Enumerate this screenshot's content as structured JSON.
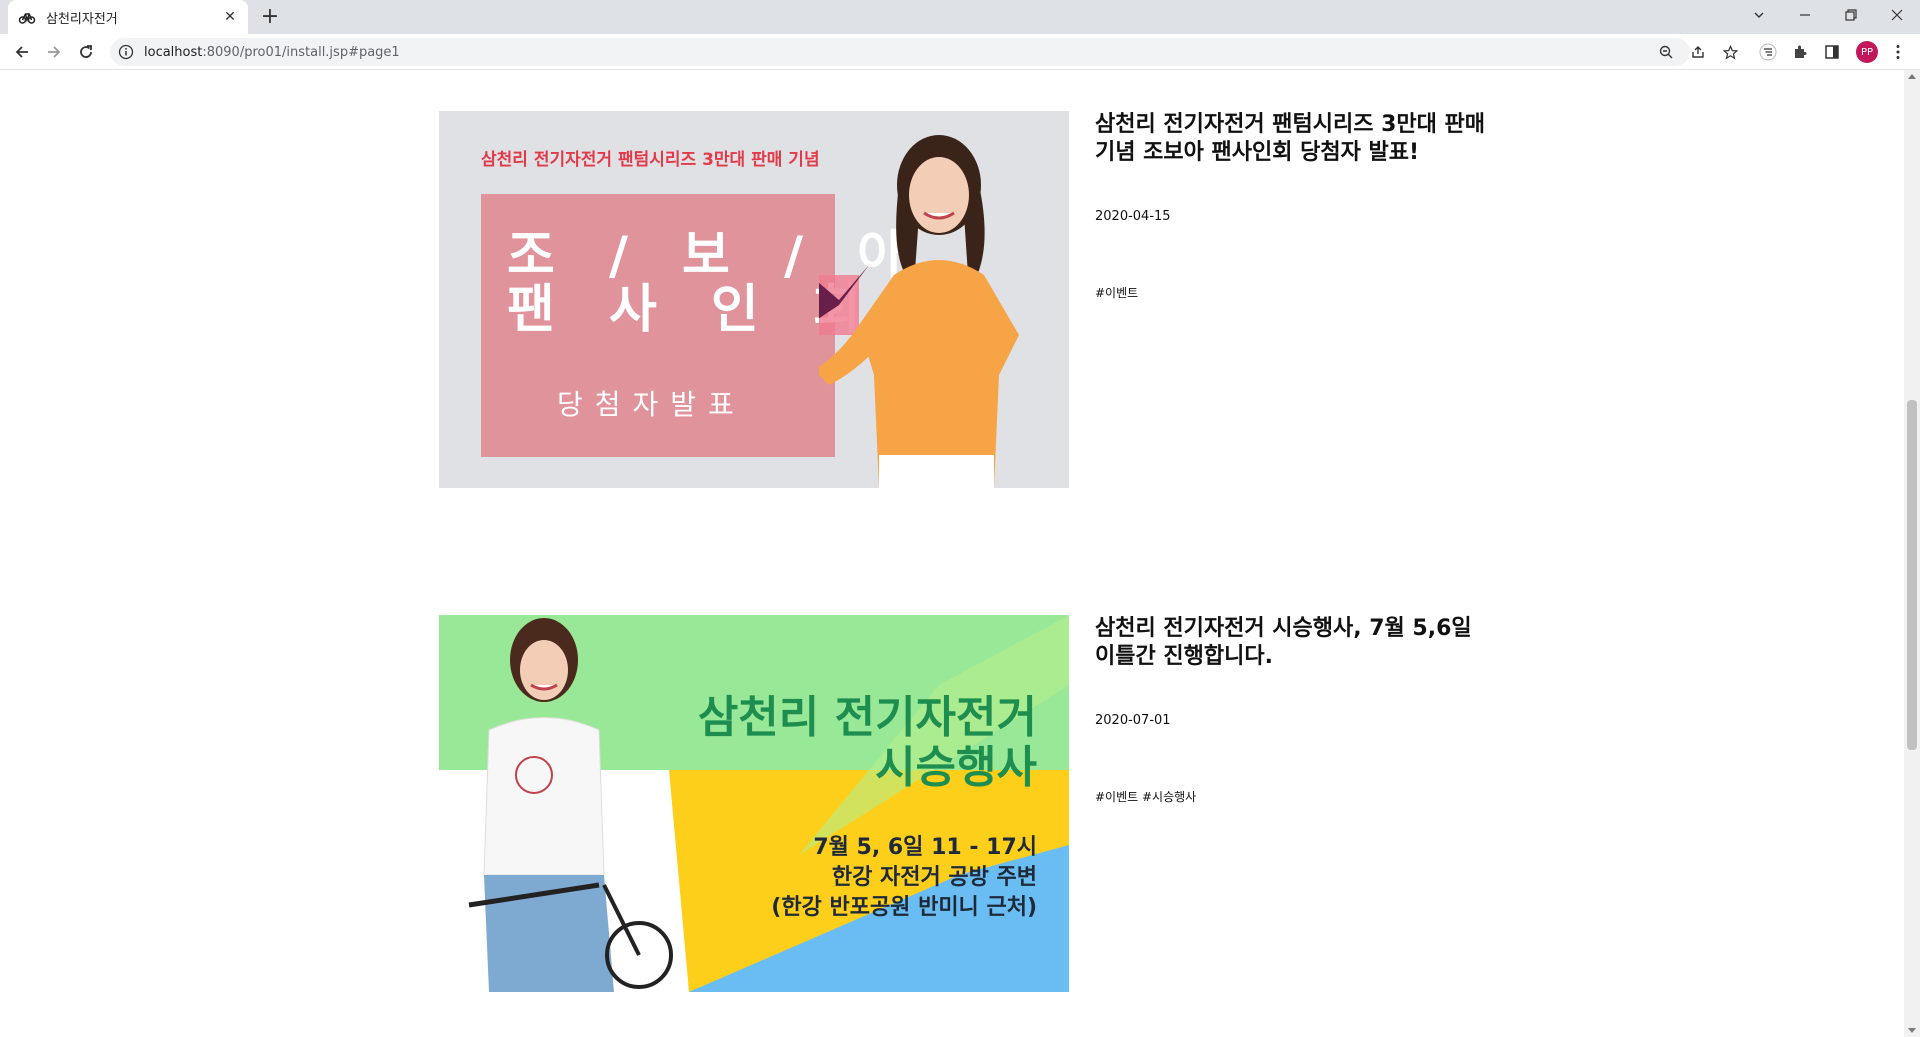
{
  "browser": {
    "tab_title": "삼천리자전거",
    "url_host": "localhost",
    "url_path": ":8090/pro01/install.jsp#page1",
    "profile_initials": "PP"
  },
  "posts": [
    {
      "title": "삼천리 전기자전거 팬텀시리즈 3만대 판매 기념 조보아 팬사인회 당첨자 발표!",
      "date": "2020-04-15",
      "tags": "#이벤트",
      "banner": {
        "top_text": "삼천리 전기자전거 팬텀시리즈 3만대 판매 기념",
        "big_line1": "조 / 보 / 아",
        "big_line2": "팬 사 인 회",
        "sub_text": "당첨자발표"
      }
    },
    {
      "title": "삼천리 전기자전거 시승행사, 7월 5,6일 이틀간 진행합니다.",
      "date": "2020-07-01",
      "tags": "#이벤트 #시승행사",
      "banner": {
        "heading_line1": "삼천리 전기자전거",
        "heading_line2": "시승행사",
        "detail_line1": "7월 5, 6일 11 - 17시",
        "detail_line2": "한강 자전거 공방 주변",
        "detail_line3": "(한강 반포공원 반미니 근처)"
      }
    }
  ],
  "colors": {
    "banner1_bg": "#dfe1e4",
    "banner1_box": "#e0939b",
    "banner1_accent": "#e33a4a",
    "banner2_green": "#98e898",
    "banner2_yellow": "#fecf1a",
    "banner2_blue": "#6abdf2",
    "banner2_text_green": "#1d8e4f"
  }
}
